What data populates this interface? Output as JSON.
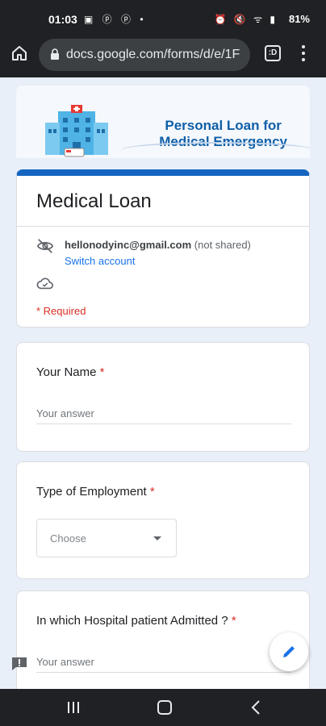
{
  "status_bar": {
    "time": "01:03",
    "battery": "81%"
  },
  "browser": {
    "url": "docs.google.com/forms/d/e/1F",
    "tab_count": ":D"
  },
  "banner": {
    "line1": "Personal Loan for",
    "line2": "Medical Emergency"
  },
  "form": {
    "title": "Medical Loan",
    "email": "hellonodyinc@gmail.com",
    "not_shared": "(not shared)",
    "switch_account": "Switch account",
    "required_note": "* Required"
  },
  "questions": [
    {
      "label": "Your Name",
      "required_mark": "*",
      "placeholder": "Your answer"
    },
    {
      "label": "Type of Employment",
      "required_mark": "*",
      "select_value": "Choose"
    },
    {
      "label": "In which Hospital patient Admitted ?",
      "required_mark": "*",
      "placeholder": "Your answer"
    }
  ],
  "colors": {
    "accent": "#1565c0",
    "required": "#d93025",
    "link": "#1a73e8"
  },
  "icons": [
    "home-icon",
    "lock-icon",
    "tabs-icon",
    "menu-icon",
    "eye-off-icon",
    "cloud-icon",
    "pen-icon",
    "feedback-icon",
    "nav-recent-icon",
    "nav-home-icon",
    "nav-back-icon"
  ]
}
